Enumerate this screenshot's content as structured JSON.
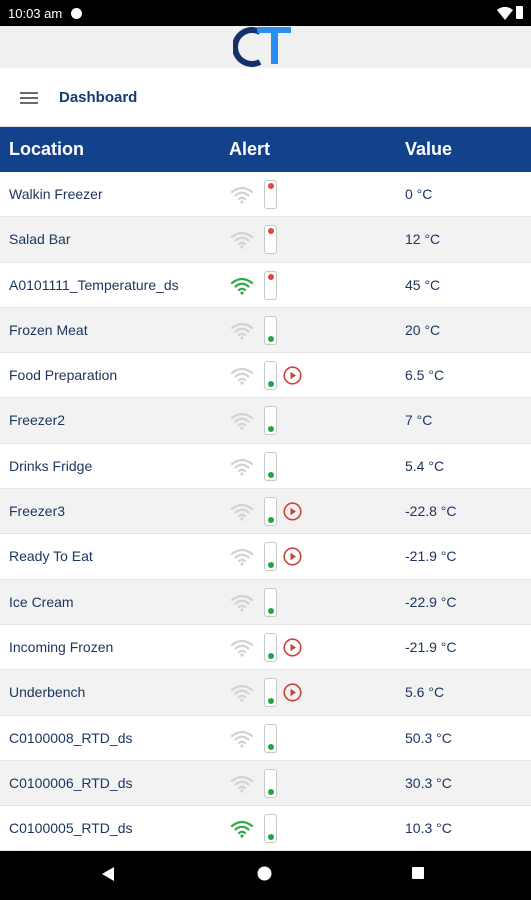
{
  "status": {
    "time": "10:03 am",
    "app_icon": "pocket-cast-icon",
    "wifi_icon": "wifi-icon",
    "battery_icon": "battery-icon"
  },
  "logo": {
    "text": "CT",
    "colors": {
      "dark": "#13306a",
      "light": "#2a8ef0"
    }
  },
  "appbar": {
    "menu_icon": "hamburger-menu-icon",
    "title": "Dashboard"
  },
  "table": {
    "headers": {
      "location": "Location",
      "alert": "Alert",
      "value": "Value"
    },
    "rows": [
      {
        "location": "Walkin Freezer",
        "value": "0 °C",
        "wifi": "weak",
        "light": "red",
        "play": false
      },
      {
        "location": "Salad Bar",
        "value": "12 °C",
        "wifi": "weak",
        "light": "red",
        "play": false
      },
      {
        "location": "A0101111_Temperature_ds",
        "value": "45 °C",
        "wifi": "strong",
        "light": "red",
        "play": false
      },
      {
        "location": "Frozen Meat",
        "value": "20 °C",
        "wifi": "weak",
        "light": "green",
        "play": false
      },
      {
        "location": "Food Preparation",
        "value": "6.5 °C",
        "wifi": "weak",
        "light": "green",
        "play": true
      },
      {
        "location": "Freezer2",
        "value": "7 °C",
        "wifi": "weak",
        "light": "green",
        "play": false
      },
      {
        "location": "Drinks Fridge",
        "value": "5.4 °C",
        "wifi": "weak",
        "light": "green",
        "play": false
      },
      {
        "location": "Freezer3",
        "value": "-22.8 °C",
        "wifi": "weak",
        "light": "green",
        "play": true
      },
      {
        "location": "Ready To Eat",
        "value": "-21.9 °C",
        "wifi": "weak",
        "light": "green",
        "play": true
      },
      {
        "location": "Ice Cream",
        "value": "-22.9 °C",
        "wifi": "weak",
        "light": "green",
        "play": false
      },
      {
        "location": "Incoming Frozen",
        "value": "-21.9 °C",
        "wifi": "weak",
        "light": "green",
        "play": true
      },
      {
        "location": "Underbench",
        "value": "5.6 °C",
        "wifi": "weak",
        "light": "green",
        "play": true
      },
      {
        "location": "C0100008_RTD_ds",
        "value": "50.3 °C",
        "wifi": "weak",
        "light": "green",
        "play": false
      },
      {
        "location": "C0100006_RTD_ds",
        "value": "30.3 °C",
        "wifi": "weak",
        "light": "green",
        "play": false
      },
      {
        "location": "C0100005_RTD_ds",
        "value": "10.3 °C",
        "wifi": "strong",
        "light": "green",
        "play": false
      }
    ]
  },
  "colors": {
    "header_bg": "#13428c",
    "text": "#1e3560",
    "wifi_weak": "#d2d2d2",
    "wifi_strong": "#2eaa48",
    "alert_red": "#e2463f",
    "alert_green": "#22a44a",
    "play_red": "#c9453a"
  },
  "navbar": {
    "back_icon": "back-triangle-icon",
    "home_icon": "home-circle-icon",
    "recents_icon": "recents-square-icon"
  }
}
